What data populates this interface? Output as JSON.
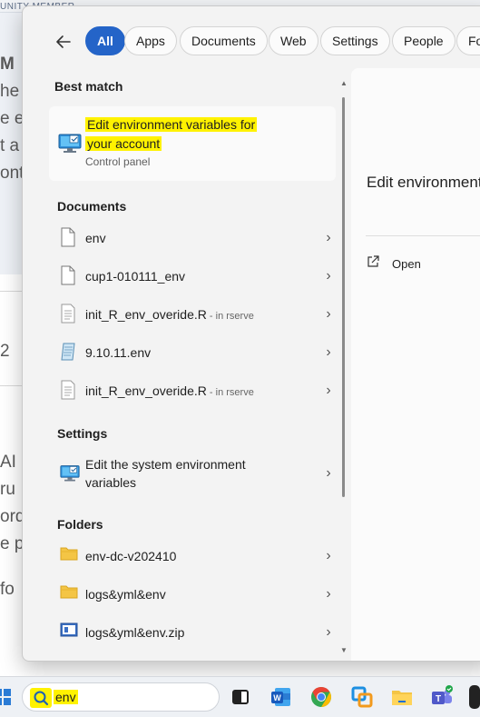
{
  "background": {
    "top_strip": "UNITY MEMBER",
    "fragments": [
      "M",
      "he",
      "e e",
      "t a",
      "ont",
      "2",
      "AI S",
      "ru",
      "ord",
      "e p",
      "fo"
    ]
  },
  "filters": {
    "back_icon": "back-arrow-icon",
    "chips": [
      "All",
      "Apps",
      "Documents",
      "Web",
      "Settings",
      "People",
      "Fo"
    ],
    "active": "All"
  },
  "best_match": {
    "heading": "Best match",
    "title_line1": "Edit environment variables for",
    "title_line2": "your account",
    "subtitle": "Control panel"
  },
  "documents": {
    "heading": "Documents",
    "items": [
      {
        "name": "env",
        "suffix": ""
      },
      {
        "name": "cup1-010111_env",
        "suffix": ""
      },
      {
        "name": "init_R_env_overide.R",
        "suffix": " - in rserve"
      },
      {
        "name": "9.10.11.env",
        "suffix": ""
      },
      {
        "name": "init_R_env_overide.R",
        "suffix": " - in rserve"
      }
    ]
  },
  "settings": {
    "heading": "Settings",
    "items": [
      {
        "name": "Edit the system environment variables"
      }
    ]
  },
  "folders": {
    "heading": "Folders",
    "items": [
      {
        "name": "env-dc-v202410"
      },
      {
        "name": "logs&yml&env"
      },
      {
        "name": "logs&yml&env.zip"
      }
    ]
  },
  "preview": {
    "title": "Edit environment variables for your account",
    "open_label": "Open"
  },
  "taskbar": {
    "search_text": "env",
    "highlight_color": "#fff200",
    "accent_color": "#2464c8"
  }
}
